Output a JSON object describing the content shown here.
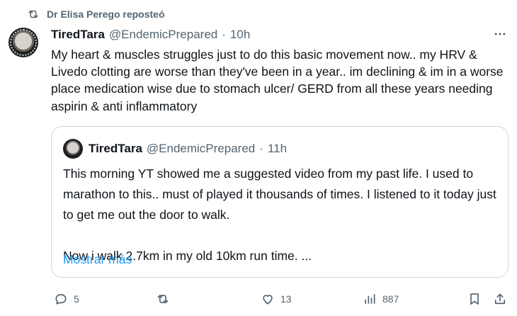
{
  "repost": {
    "label": "Dr Elisa Perego reposteó",
    "icon": "repost-icon"
  },
  "tweet": {
    "name": "TiredTara",
    "handle": "@EndemicPrepared",
    "separator": "·",
    "time": "10h",
    "text": "My heart & muscles struggles just to do this basic movement now.. my HRV & Livedo clotting are worse than they've been in a year.. im declining & im in a worse place medication wise due to stomach ulcer/ GERD from all these years needing aspirin & anti inflammatory"
  },
  "quote": {
    "name": "TiredTara",
    "handle": "@EndemicPrepared",
    "separator": "·",
    "time": "11h",
    "text": "This morning YT showed me a suggested video from my past life. I used to marathon to this.. must of played it thousands of times. I listened to it today just to get me out the door to walk.\n\nNow i walk 2.7km in my old 10km run time. ...",
    "show_more": "Mostrar más"
  },
  "actions": {
    "replies": "5",
    "reposts": "",
    "likes": "13",
    "views": "887"
  },
  "colors": {
    "accent": "#1d9bf0",
    "muted": "#536471",
    "text": "#0f1419",
    "border": "#cfd9de"
  }
}
